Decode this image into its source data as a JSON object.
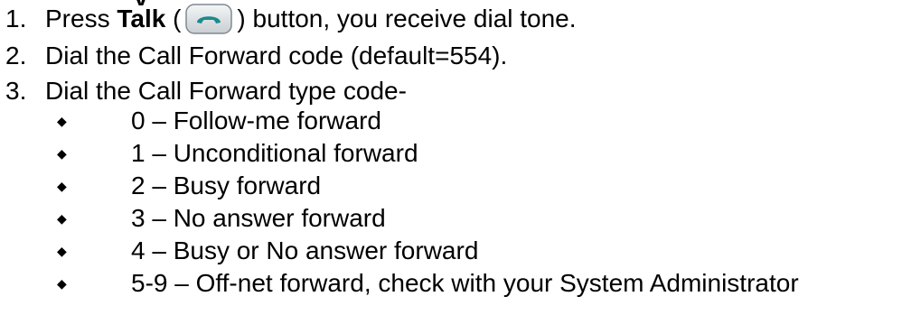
{
  "top_fragment": "y",
  "steps": [
    {
      "number": "1.",
      "prefix": "Press ",
      "bold": "Talk",
      "open_paren": " (",
      "icon": "phone-talk-icon",
      "suffix": ") button, you receive dial tone."
    },
    {
      "number": "2.",
      "text": "Dial the Call Forward code (default=554)."
    },
    {
      "number": "3.",
      "text": "Dial the Call Forward type code-"
    }
  ],
  "bullet_glyph": "◆",
  "forward_types": [
    "0 – Follow-me forward",
    "1 – Unconditional forward",
    "2 – Busy forward",
    "3 – No answer forward",
    "4 – Busy or No answer forward",
    "5-9 – Off-net forward, check with your System Administrator"
  ],
  "colors": {
    "button_bg_top": "#f4f6f7",
    "button_bg_bottom": "#c9ced2",
    "button_border": "#7f8a90",
    "handset": "#1c8a8c"
  }
}
